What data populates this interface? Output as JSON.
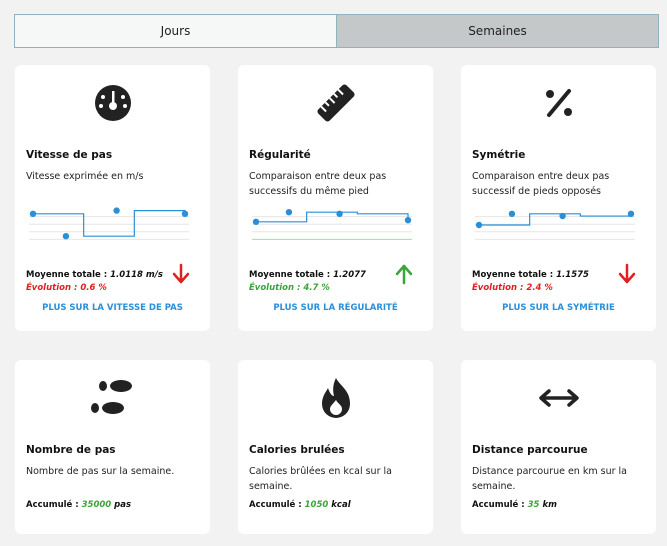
{
  "tabs": {
    "days": "Jours",
    "weeks": "Semaines"
  },
  "metrics": [
    {
      "title": "Vitesse de pas",
      "description": "Vitesse exprimée en m/s",
      "average_label": "Moyenne totale :",
      "average_value": "1.0118 m/s",
      "evolution": "Évolution : 0.6 %",
      "trend": "down",
      "link": "PLUS SUR LA VITESSE DE PAS",
      "icon": "speedometer-icon",
      "series": [
        0.85,
        0.15,
        0.95,
        0.85
      ]
    },
    {
      "title": "Régularité",
      "description": "Comparaison entre deux pas successifs du même pied",
      "average_label": "Moyenne totale :",
      "average_value": "1.2077",
      "evolution": "Évolution : 4.7 %",
      "trend": "up",
      "link": "PLUS SUR LA RÉGULARITÉ",
      "icon": "ruler-icon",
      "series": [
        0.6,
        0.9,
        0.85,
        0.65
      ]
    },
    {
      "title": "Symétrie",
      "description": "Comparaison entre deux pas successif de pieds opposés",
      "average_label": "Moyenne totale :",
      "average_value": "1.1575",
      "evolution": "Évolution : 2.4 %",
      "trend": "down",
      "link": "PLUS SUR LA SYMÉTRIE",
      "icon": "percent-icon",
      "series": [
        0.5,
        0.85,
        0.78,
        0.85
      ]
    }
  ],
  "totals": [
    {
      "title": "Nombre de pas",
      "description": "Nombre de pas sur la semaine.",
      "label": "Accumulé :",
      "value": "35000",
      "unit": "pas",
      "icon": "footprints-icon"
    },
    {
      "title": "Calories brulées",
      "description": "Calories brûlées en kcal sur la semaine.",
      "label": "Accumulé :",
      "value": "1050",
      "unit": "kcal",
      "icon": "flame-icon"
    },
    {
      "title": "Distance parcourue",
      "description": "Distance parcourue en km sur la semaine.",
      "label": "Accumulé :",
      "value": "35",
      "unit": "km",
      "icon": "double-arrow-icon"
    }
  ]
}
